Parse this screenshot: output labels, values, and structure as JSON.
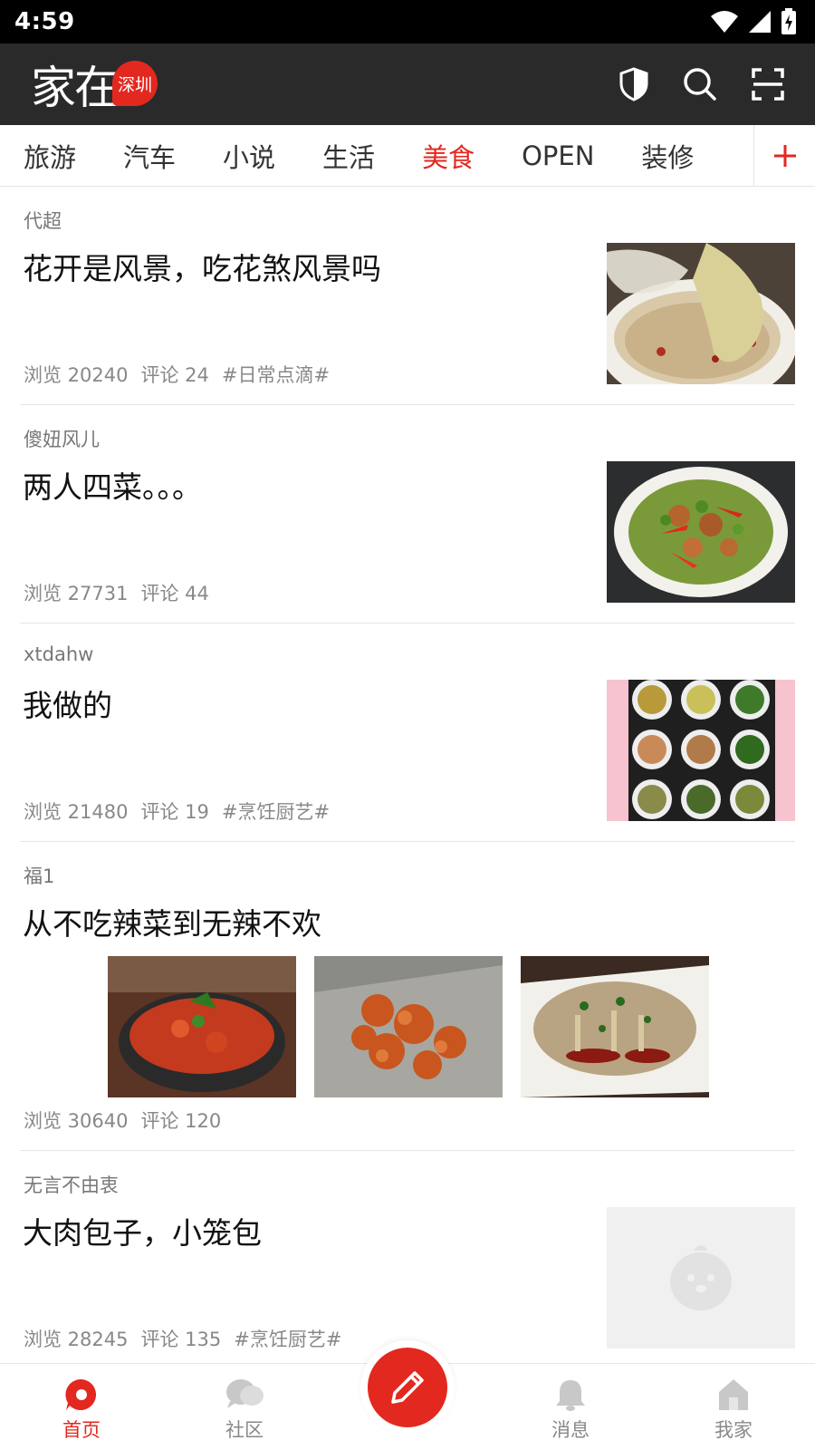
{
  "status_bar": {
    "time": "4:59"
  },
  "header": {
    "logo_text": "家在",
    "logo_city": "深圳"
  },
  "tabs": [
    {
      "label": "旅游",
      "active": false
    },
    {
      "label": "汽车",
      "active": false
    },
    {
      "label": "小说",
      "active": false
    },
    {
      "label": "生活",
      "active": false
    },
    {
      "label": "美食",
      "active": true
    },
    {
      "label": "OPEN",
      "active": false
    },
    {
      "label": "装修",
      "active": false
    }
  ],
  "posts": [
    {
      "author": "代超",
      "title": "花开是风景，吃花煞风景吗",
      "views": "浏览 20240",
      "comments": "评论 24",
      "tag": "#日常点滴#",
      "thumb": "dessert-bowl-image"
    },
    {
      "author": "傻妞风儿",
      "title": "两人四菜。。。",
      "views": "浏览 27731",
      "comments": "评论 44",
      "tag": "",
      "thumb": "stirfry-plate-image"
    },
    {
      "author": "xtdahw",
      "title": "我做的",
      "views": "浏览 21480",
      "comments": "评论 19",
      "tag": "#烹饪厨艺#",
      "thumb": "dish-grid-image"
    },
    {
      "author": "福1",
      "title": "从不吃辣菜到无辣不欢",
      "views": "浏览 30640",
      "comments": "评论 120",
      "tag": "",
      "thumbs": [
        "spicy-pot-image",
        "fried-dish-image",
        "cold-dish-image"
      ]
    },
    {
      "author": "无言不由衷",
      "title": "大肉包子，小笼包",
      "views": "浏览 28245",
      "comments": "评论 135",
      "tag": "#烹饪厨艺#",
      "thumb": "placeholder-mascot-image"
    }
  ],
  "bottom_nav": {
    "home": "首页",
    "community": "社区",
    "messages": "消息",
    "mine": "我家"
  },
  "colors": {
    "accent": "#e3281f",
    "header_bg": "#2a2a2a"
  }
}
